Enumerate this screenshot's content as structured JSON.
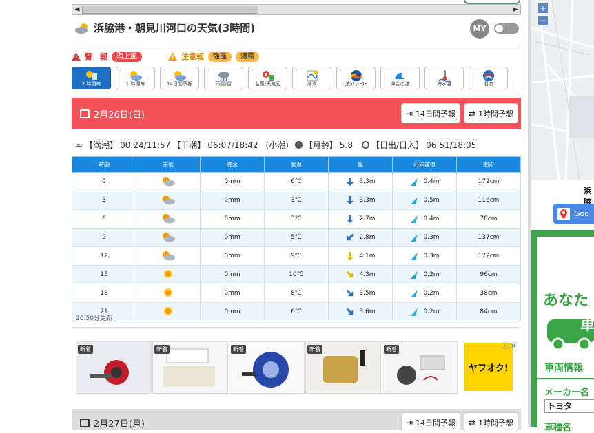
{
  "header": {
    "title": "浜脇港・朝見川河口の天気(3時間)",
    "my_label": "MY"
  },
  "alerts": {
    "warning_label": "警　報",
    "warning_items": [
      "海上風"
    ],
    "advisory_label": "注意報",
    "advisory_items": [
      "強風",
      "濃霧"
    ]
  },
  "tools": [
    {
      "label": "3 時間毎",
      "icon": "sun-cloud-icon",
      "active": true
    },
    {
      "label": "1 時間毎",
      "icon": "sun-cloud-icon",
      "active": false
    },
    {
      "label": "14日間予報",
      "icon": "sun-cloud-icon",
      "active": false
    },
    {
      "label": "雨雲/雷",
      "icon": "rain-cloud-icon",
      "active": false
    },
    {
      "label": "台風/天気図",
      "icon": "typhoon-icon",
      "active": false
    },
    {
      "label": "潮汐",
      "icon": "tide-chart-icon",
      "active": false
    },
    {
      "label": "波ｼﾐｭﾚｰﾀｰ",
      "icon": "wave-sim-icon",
      "active": false
    },
    {
      "label": "沖合の波",
      "icon": "offshore-wave-icon",
      "active": false
    },
    {
      "label": "海水温",
      "icon": "sea-temp-icon",
      "active": false
    },
    {
      "label": "潮流",
      "icon": "current-icon",
      "active": false
    }
  ],
  "day1": {
    "date": "2月26日(日)",
    "btn_14day": "14日間予報",
    "btn_1hour": "1時間予想",
    "tide_info": {
      "high_label": "【満潮】",
      "high": "00:24/11:57",
      "low_label": "【干潮】",
      "low": "06:07/18:42",
      "tide_type": "(小潮)",
      "moon_label": "【月齢】",
      "moon": "5.8",
      "sun_label": "【日出/日入】",
      "sun": "06:51/18:05"
    }
  },
  "table": {
    "headers": [
      "時間",
      "天気",
      "降水",
      "気温",
      "風",
      "沿岸波浪",
      "潮汐"
    ],
    "rows": [
      {
        "time": "0",
        "weather": "sun-cloud",
        "rain": "0mm",
        "temp": "6℃",
        "wind_dir": "S",
        "wind": "3.3m",
        "wave_dir": "ne",
        "wave": "0.4m",
        "tide": "172cm"
      },
      {
        "time": "3",
        "weather": "sun-cloud",
        "rain": "0mm",
        "temp": "3℃",
        "wind_dir": "S",
        "wind": "3.3m",
        "wave_dir": "ne",
        "wave": "0.5m",
        "tide": "116cm"
      },
      {
        "time": "6",
        "weather": "sun-cloud",
        "rain": "0mm",
        "temp": "3℃",
        "wind_dir": "S",
        "wind": "2.7m",
        "wave_dir": "ne",
        "wave": "0.4m",
        "tide": "78cm"
      },
      {
        "time": "9",
        "weather": "sun-cloud",
        "rain": "0mm",
        "temp": "5℃",
        "wind_dir": "SW",
        "wind": "2.8m",
        "wave_dir": "ne",
        "wave": "0.3m",
        "tide": "137cm"
      },
      {
        "time": "12",
        "weather": "sun-cloud",
        "rain": "0mm",
        "temp": "9℃",
        "wind_dir": "S",
        "wind": "4.1m",
        "wave_dir": "ne",
        "wave": "0.3m",
        "tide": "172cm"
      },
      {
        "time": "15",
        "weather": "sun",
        "rain": "0mm",
        "temp": "10℃",
        "wind_dir": "SE",
        "wind": "4.3m",
        "wave_dir": "ne",
        "wave": "0.2m",
        "tide": "96cm"
      },
      {
        "time": "18",
        "weather": "sun",
        "rain": "0mm",
        "temp": "8℃",
        "wind_dir": "SE",
        "wind": "3.5m",
        "wave_dir": "ne",
        "wave": "0.2m",
        "tide": "38cm"
      },
      {
        "time": "21",
        "weather": "sun",
        "rain": "0mm",
        "temp": "6℃",
        "wind_dir": "SE",
        "wind": "3.6m",
        "wave_dir": "ne",
        "wave": "0.2m",
        "tide": "84cm"
      }
    ],
    "wind_colors": {
      "blue": "#2c6fbf",
      "yellow": "#e8b800"
    }
  },
  "updated": "20:50分更新",
  "ads": {
    "badge": "新着",
    "cards": 5,
    "yahoo": "ヤフオク!"
  },
  "day2": {
    "date": "2月27日(月)",
    "btn_14day": "14日間予報",
    "btn_1hour": "1時間予想"
  },
  "sidebar": {
    "map_zoom_in": "+",
    "map_zoom_out": "−",
    "place_title": "浜脇",
    "google_btn": "Goo",
    "car_ad": {
      "headline": "あなた",
      "car_char": "車",
      "section": "車両情報",
      "maker_label": "メーカー名",
      "maker_value": "トヨタ",
      "type_label": "車種名"
    }
  },
  "colors": {
    "date_bar": "#f5535a",
    "table_header": "#1a8ae0",
    "tool_active": "#1c6fc3",
    "warning_pill": "#f04848",
    "advisory_pill": "#f6b94a"
  }
}
